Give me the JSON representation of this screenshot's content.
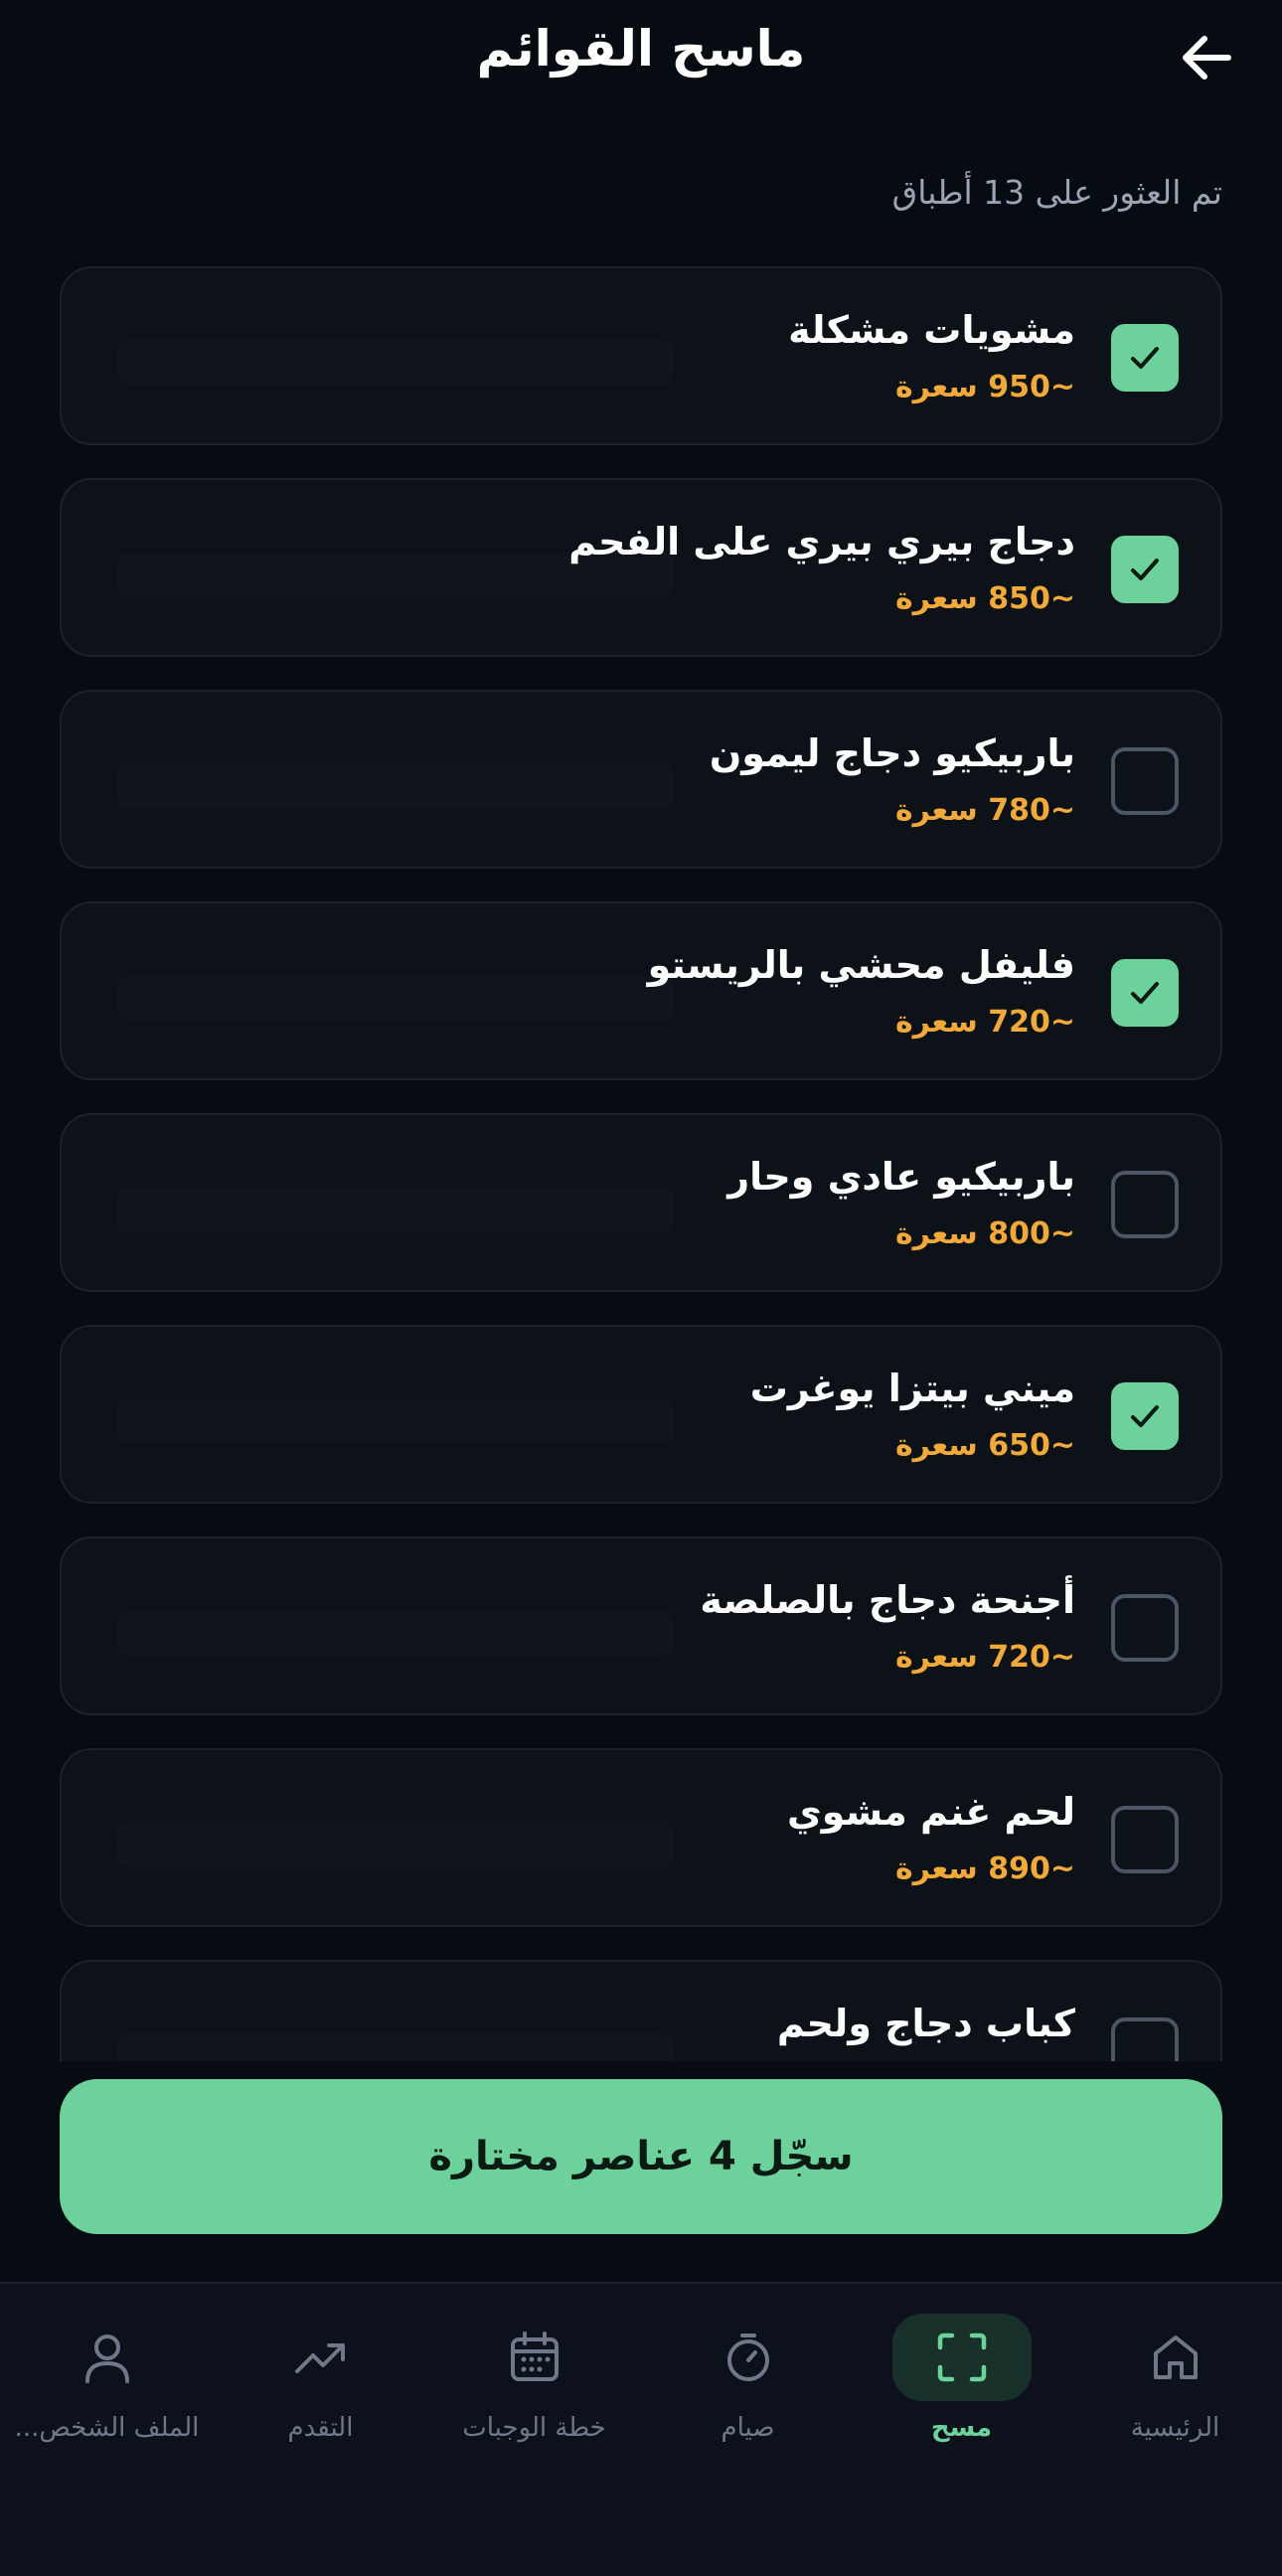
{
  "header": {
    "title": "ماسح القوائم"
  },
  "summary": {
    "found_text": "تم العثور على 13 أطباق"
  },
  "dishes": [
    {
      "name": "مشويات مشكلة",
      "calories": "~950 سعرة",
      "checked": true
    },
    {
      "name": "دجاج بيري بيري على الفحم",
      "calories": "~850 سعرة",
      "checked": true
    },
    {
      "name": "باربيكيو دجاج ليمون",
      "calories": "~780 سعرة",
      "checked": false
    },
    {
      "name": "فليفل محشي بالريستو",
      "calories": "~720 سعرة",
      "checked": true
    },
    {
      "name": "باربيكيو عادي وحار",
      "calories": "~800 سعرة",
      "checked": false
    },
    {
      "name": "ميني بيتزا يوغرت",
      "calories": "~650 سعرة",
      "checked": true
    },
    {
      "name": "أجنحة دجاج بالصلصة",
      "calories": "~720 سعرة",
      "checked": false
    },
    {
      "name": "لحم غنم مشوي",
      "calories": "~890 سعرة",
      "checked": false
    },
    {
      "name": "كباب دجاج ولحم",
      "calories": "",
      "checked": false
    }
  ],
  "cta": {
    "label": "سجّل 4 عناصر مختارة"
  },
  "nav": {
    "items": [
      {
        "label": "الرئيسية",
        "icon": "home-icon",
        "active": false
      },
      {
        "label": "مسح",
        "icon": "scan-icon",
        "active": true
      },
      {
        "label": "صيام",
        "icon": "stopwatch-icon",
        "active": false
      },
      {
        "label": "خطة الوجبات",
        "icon": "calendar-icon",
        "active": false
      },
      {
        "label": "التقدم",
        "icon": "trending-up-icon",
        "active": false
      },
      {
        "label": "الملف الشخص...",
        "icon": "user-icon",
        "active": false
      }
    ]
  },
  "colors": {
    "accent": "#6dd19b",
    "calories": "#f0a93a",
    "background": "#070b12",
    "card": "#0d1118"
  }
}
